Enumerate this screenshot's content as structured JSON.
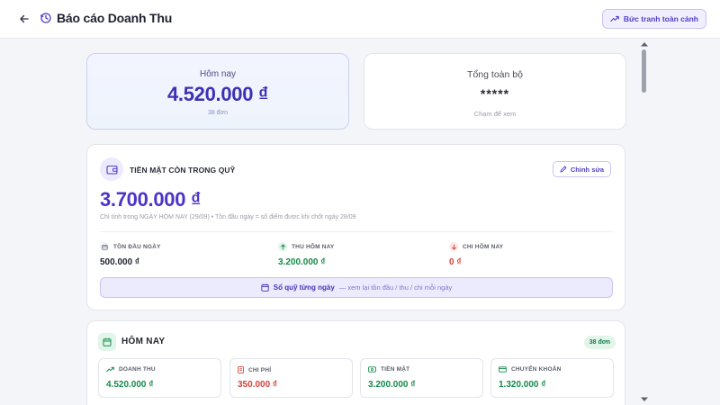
{
  "header": {
    "title": "Báo cáo Doanh Thu",
    "overview_button": "Bức tranh toàn cảnh"
  },
  "today_card": {
    "label": "Hôm nay",
    "value": "4.520.000 ₫",
    "orders": "38 đơn"
  },
  "total_card": {
    "label": "Tổng toàn bộ",
    "value": "*****",
    "hint": "Chạm để xem"
  },
  "cash_fund": {
    "title": "TIỀN MẶT CÒN TRONG QUỸ",
    "edit_button": "Chỉnh sửa",
    "amount": "3.700.000 ₫",
    "note": "Chỉ tính trong NGÀY HÔM NAY (29/09) • Tồn đầu ngày = số điểm được khi chốt ngày 28/09",
    "metrics": [
      {
        "label": "TỒN ĐẦU NGÀY",
        "value": "500.000 ₫"
      },
      {
        "label": "THU HÔM NAY",
        "value": "3.200.000 ₫"
      },
      {
        "label": "CHI HÔM NAY",
        "value": "0 ₫"
      }
    ],
    "ledger_button": "Sổ quỹ từng ngày",
    "ledger_sub": "— xem lại tồn đầu / thu / chi mỗi ngày"
  },
  "today_section": {
    "title": "HÔM NAY",
    "badge": "38 đơn",
    "stats": [
      {
        "label": "DOANH THU",
        "value": "4.520.000 ₫"
      },
      {
        "label": "CHI PHÍ",
        "value": "350.000 ₫"
      },
      {
        "label": "TIỀN MẶT",
        "value": "3.200.000 ₫"
      },
      {
        "label": "CHUYỂN KHOẢN",
        "value": "1.320.000 ₫"
      }
    ]
  },
  "colors": {
    "accent": "#4f3fc7",
    "green": "#158a4a",
    "red": "#d9413b"
  },
  "icons": {
    "back": "arrow-left-icon",
    "history": "history-icon",
    "overview": "trending-up-icon",
    "wallet": "wallet-icon",
    "edit": "pencil-icon",
    "ledger": "calendar-icon"
  }
}
